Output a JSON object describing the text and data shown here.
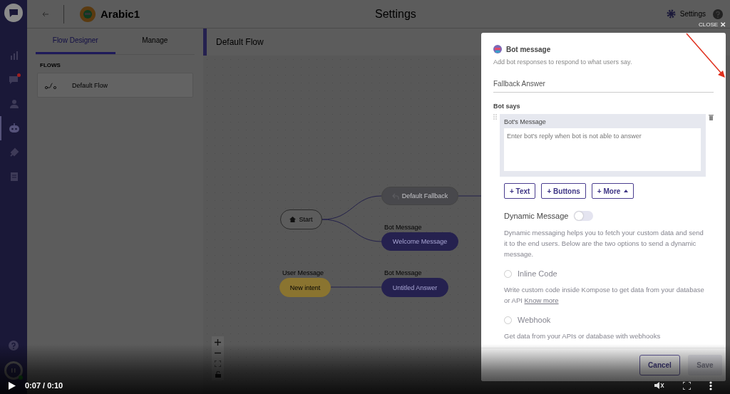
{
  "nav_rail": {
    "items": [
      {
        "selected": false,
        "badge": false
      },
      {
        "selected": false,
        "badge": true
      },
      {
        "selected": false,
        "badge": false
      },
      {
        "selected": true,
        "badge": false
      },
      {
        "selected": false,
        "badge": false
      },
      {
        "selected": false,
        "badge": false
      }
    ]
  },
  "header": {
    "bot_name": "Arabic1",
    "title": "Settings",
    "settings_link": "Settings"
  },
  "flow_panel": {
    "tabs": [
      {
        "label": "Flow Designer",
        "selected": true
      },
      {
        "label": "Manage",
        "selected": false
      }
    ],
    "section": "FLOWS",
    "flows": [
      {
        "label": "Default Flow",
        "selected": true
      }
    ]
  },
  "canvas": {
    "title": "Default Flow",
    "nodes": [
      {
        "kind": "start",
        "label": "Start"
      },
      {
        "kind": "fallback",
        "label": "Default Fallback"
      },
      {
        "kind": "bot",
        "caption": "Bot Message",
        "label": "Welcome Message"
      },
      {
        "kind": "user",
        "caption": "User Message",
        "label": "New intent"
      },
      {
        "kind": "bot",
        "caption": "Bot Message",
        "label": "Untitled Answer"
      }
    ]
  },
  "modal": {
    "close_label": "CLOSE",
    "close_glyph": "✕",
    "title": "Bot message",
    "subtitle": "Add bot responses to respond to what users say.",
    "name_value": "Fallback Answer",
    "bot_says": "Bot says",
    "card_title": "Bot's Message",
    "message_placeholder": "Enter bot's reply when bot is not able to answer",
    "add_buttons": [
      {
        "label": "+ Text",
        "kind": "plain"
      },
      {
        "label": "+ Buttons",
        "kind": "plain"
      },
      {
        "label": "+ More",
        "kind": "menu"
      }
    ],
    "dynamic": {
      "label": "Dynamic Message",
      "on": false,
      "description": "Dynamic messaging helps you to fetch your custom data and send it to the end users. Below are the two options to send a dynamic message."
    },
    "options": [
      {
        "label": "Inline Code",
        "selected": false,
        "description": "Write custom code inside Kompose to get data from your database or API",
        "link": "Know more"
      },
      {
        "label": "Webhook",
        "selected": false,
        "description": "Get data from your APIs or database with webhooks"
      }
    ],
    "cancel": "Cancel",
    "save": {
      "label": "Save",
      "disabled": true
    }
  },
  "video": {
    "time": "0:07 / 0:10"
  }
}
